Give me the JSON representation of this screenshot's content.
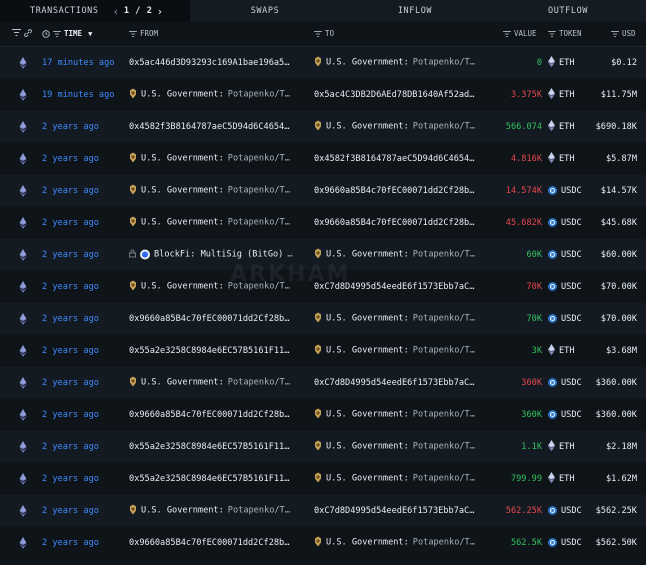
{
  "tabs": {
    "transactions": "TRANSACTIONS",
    "page": "1 / 2",
    "swaps": "SWAPS",
    "inflow": "INFLOW",
    "outflow": "OUTFLOW"
  },
  "columns": {
    "time": "TIME",
    "from": "FROM",
    "to": "TO",
    "value": "VALUE",
    "token": "TOKEN",
    "usd": "USD"
  },
  "watermark": "ARKHAM",
  "rows": [
    {
      "time": "17 minutes ago",
      "from": {
        "kind": "addr",
        "text": "0x5ac446d3D93293c169A1bae196a5…"
      },
      "to": {
        "kind": "gov",
        "name": "U.S. Government:",
        "sub": "Potapenko/T…"
      },
      "value": "0",
      "vclass": "pos",
      "token": "ETH",
      "ticon": "eth",
      "usd": "$0.12"
    },
    {
      "time": "19 minutes ago",
      "from": {
        "kind": "gov",
        "name": "U.S. Government:",
        "sub": "Potapenko/T…"
      },
      "to": {
        "kind": "addr",
        "text": "0x5ac4C3DB2D6AEd78DB1640Af52ad…"
      },
      "value": "3.375K",
      "vclass": "neg",
      "token": "ETH",
      "ticon": "eth",
      "usd": "$11.75M"
    },
    {
      "time": "2 years ago",
      "from": {
        "kind": "addr",
        "text": "0x4582f3B8164787aeC5D94d6C4654…"
      },
      "to": {
        "kind": "gov",
        "name": "U.S. Government:",
        "sub": "Potapenko/T…"
      },
      "value": "566.074",
      "vclass": "pos",
      "token": "ETH",
      "ticon": "eth",
      "usd": "$690.18K"
    },
    {
      "time": "2 years ago",
      "from": {
        "kind": "gov",
        "name": "U.S. Government:",
        "sub": "Potapenko/T…"
      },
      "to": {
        "kind": "addr",
        "text": "0x4582f3B8164787aeC5D94d6C4654…"
      },
      "value": "4.816K",
      "vclass": "neg",
      "token": "ETH",
      "ticon": "eth",
      "usd": "$5.87M"
    },
    {
      "time": "2 years ago",
      "from": {
        "kind": "gov",
        "name": "U.S. Government:",
        "sub": "Potapenko/T…"
      },
      "to": {
        "kind": "addr",
        "text": "0x9660a85B4c70fEC00071dd2Cf28b…"
      },
      "value": "14.574K",
      "vclass": "neg",
      "token": "USDC",
      "ticon": "usdc",
      "usd": "$14.57K"
    },
    {
      "time": "2 years ago",
      "from": {
        "kind": "gov",
        "name": "U.S. Government:",
        "sub": "Potapenko/T…"
      },
      "to": {
        "kind": "addr",
        "text": "0x9660a85B4c70fEC00071dd2Cf28b…"
      },
      "value": "45.682K",
      "vclass": "neg",
      "token": "USDC",
      "ticon": "usdc",
      "usd": "$45.68K"
    },
    {
      "time": "2 years ago",
      "from": {
        "kind": "bitgo",
        "name": "BlockFi: MultiSig (BitGo)",
        "sub": "…"
      },
      "to": {
        "kind": "gov",
        "name": "U.S. Government:",
        "sub": "Potapenko/T…"
      },
      "value": "60K",
      "vclass": "pos",
      "token": "USDC",
      "ticon": "usdc",
      "usd": "$60.00K"
    },
    {
      "time": "2 years ago",
      "from": {
        "kind": "gov",
        "name": "U.S. Government:",
        "sub": "Potapenko/T…"
      },
      "to": {
        "kind": "addr",
        "text": "0xC7d8D4995d54eedE6f1573Ebb7aC…"
      },
      "value": "70K",
      "vclass": "neg",
      "token": "USDC",
      "ticon": "usdc",
      "usd": "$70.00K"
    },
    {
      "time": "2 years ago",
      "from": {
        "kind": "addr",
        "text": "0x9660a85B4c70fEC00071dd2Cf28b…"
      },
      "to": {
        "kind": "gov",
        "name": "U.S. Government:",
        "sub": "Potapenko/T…"
      },
      "value": "70K",
      "vclass": "pos",
      "token": "USDC",
      "ticon": "usdc",
      "usd": "$70.00K"
    },
    {
      "time": "2 years ago",
      "from": {
        "kind": "addr",
        "text": "0x55a2e3258C8984e6EC57B5161F11…"
      },
      "to": {
        "kind": "gov",
        "name": "U.S. Government:",
        "sub": "Potapenko/T…"
      },
      "value": "3K",
      "vclass": "pos",
      "token": "ETH",
      "ticon": "eth",
      "usd": "$3.68M"
    },
    {
      "time": "2 years ago",
      "from": {
        "kind": "gov",
        "name": "U.S. Government:",
        "sub": "Potapenko/T…"
      },
      "to": {
        "kind": "addr",
        "text": "0xC7d8D4995d54eedE6f1573Ebb7aC…"
      },
      "value": "360K",
      "vclass": "neg",
      "token": "USDC",
      "ticon": "usdc",
      "usd": "$360.00K"
    },
    {
      "time": "2 years ago",
      "from": {
        "kind": "addr",
        "text": "0x9660a85B4c70fEC00071dd2Cf28b…"
      },
      "to": {
        "kind": "gov",
        "name": "U.S. Government:",
        "sub": "Potapenko/T…"
      },
      "value": "360K",
      "vclass": "pos",
      "token": "USDC",
      "ticon": "usdc",
      "usd": "$360.00K"
    },
    {
      "time": "2 years ago",
      "from": {
        "kind": "addr",
        "text": "0x55a2e3258C8984e6EC57B5161F11…"
      },
      "to": {
        "kind": "gov",
        "name": "U.S. Government:",
        "sub": "Potapenko/T…"
      },
      "value": "1.1K",
      "vclass": "pos",
      "token": "ETH",
      "ticon": "eth",
      "usd": "$2.18M"
    },
    {
      "time": "2 years ago",
      "from": {
        "kind": "addr",
        "text": "0x55a2e3258C8984e6EC57B5161F11…"
      },
      "to": {
        "kind": "gov",
        "name": "U.S. Government:",
        "sub": "Potapenko/T…"
      },
      "value": "799.99",
      "vclass": "pos",
      "token": "ETH",
      "ticon": "eth",
      "usd": "$1.62M"
    },
    {
      "time": "2 years ago",
      "from": {
        "kind": "gov",
        "name": "U.S. Government:",
        "sub": "Potapenko/T…"
      },
      "to": {
        "kind": "addr",
        "text": "0xC7d8D4995d54eedE6f1573Ebb7aC…"
      },
      "value": "562.25K",
      "vclass": "neg",
      "token": "USDC",
      "ticon": "usdc",
      "usd": "$562.25K"
    },
    {
      "time": "2 years ago",
      "from": {
        "kind": "addr",
        "text": "0x9660a85B4c70fEC00071dd2Cf28b…"
      },
      "to": {
        "kind": "gov",
        "name": "U.S. Government:",
        "sub": "Potapenko/T…"
      },
      "value": "562.5K",
      "vclass": "pos",
      "token": "USDC",
      "ticon": "usdc",
      "usd": "$562.50K"
    }
  ]
}
